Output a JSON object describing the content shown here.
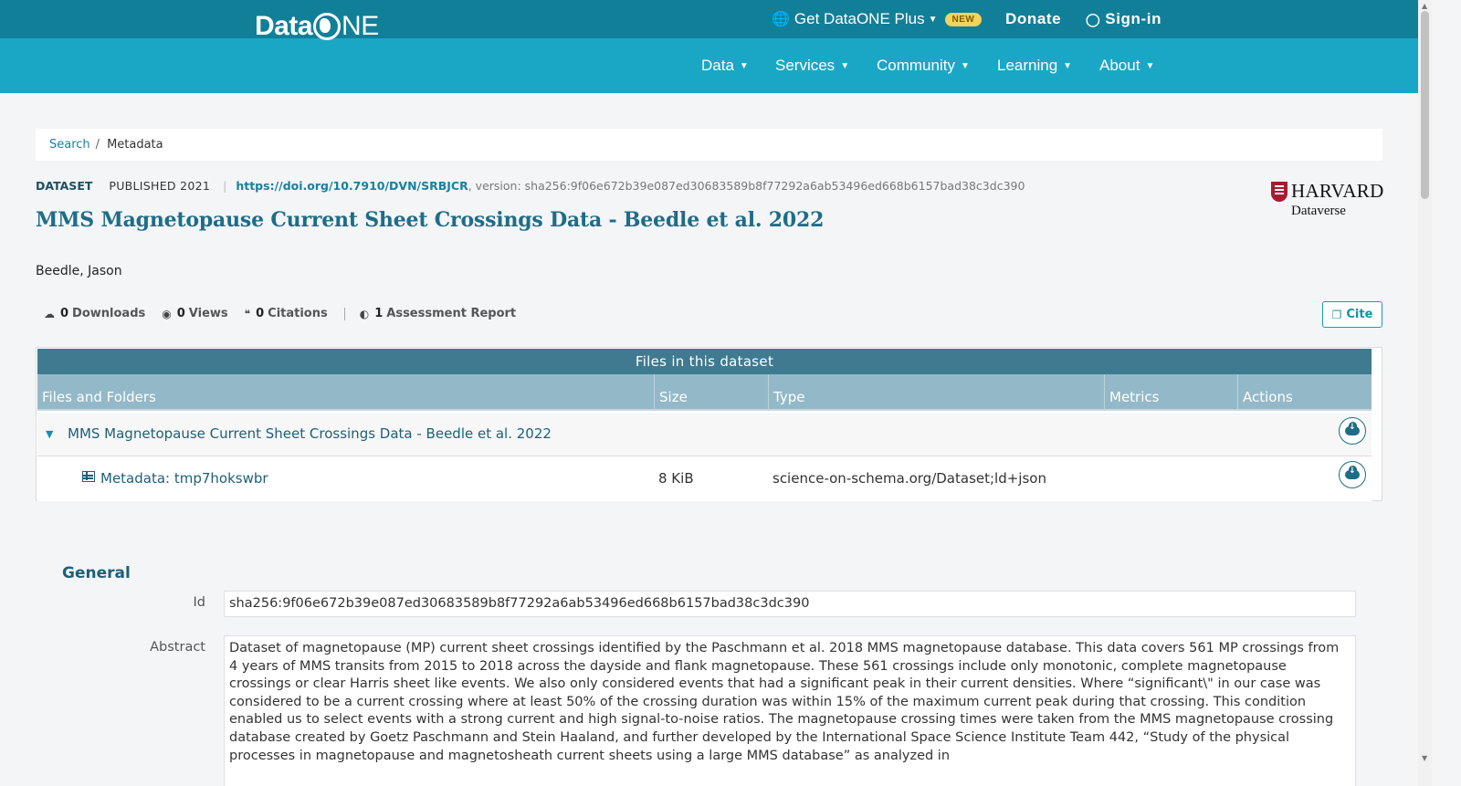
{
  "utility": {
    "plus_label": "Get DataONE Plus",
    "new_badge": "NEW",
    "donate": "Donate",
    "signin": "Sign-in"
  },
  "nav": {
    "logo_a": "Data",
    "logo_b": "NE",
    "items": [
      "Data",
      "Services",
      "Community",
      "Learning",
      "About"
    ]
  },
  "breadcrumb": {
    "search": "Search",
    "separator": "/",
    "current": "Metadata"
  },
  "dataset": {
    "type": "DATASET",
    "published": "PUBLISHED 2021",
    "doi": "https://doi.org/10.7910/DVN/SRBJCR",
    "version": ", version: sha256:9f06e672b39e087ed30683589b8f77292a6ab53496ed668b6157bad38c3dc390",
    "title": "MMS Magnetopause Current Sheet Crossings Data - Beedle et al. 2022",
    "author": "Beedle, Jason",
    "repository_name": "HARVARD",
    "repository_sub": "Dataverse"
  },
  "stats": {
    "downloads_num": "0",
    "downloads_lbl": "Downloads",
    "views_num": "0",
    "views_lbl": "Views",
    "citations_num": "0",
    "citations_lbl": "Citations",
    "assessment_num": "1",
    "assessment_lbl": "Assessment Report",
    "cite_label": "Cite"
  },
  "files": {
    "caption": "Files in this dataset",
    "columns": [
      "Files and Folders",
      "Size",
      "Type",
      "Metrics",
      "Actions"
    ],
    "folder_name": "MMS Magnetopause Current Sheet Crossings Data - Beedle et al. 2022",
    "file": {
      "name": "Metadata: tmp7hokswbr",
      "size": "8 KiB",
      "type": "science-on-schema.org/Dataset;ld+json"
    }
  },
  "general": {
    "heading": "General",
    "id_label": "Id",
    "id_value": "sha256:9f06e672b39e087ed30683589b8f77292a6ab53496ed668b6157bad38c3dc390",
    "abstract_label": "Abstract",
    "abstract_value": "Dataset of magnetopause (MP) current sheet crossings identified by the Paschmann et al. 2018 MMS magnetopause database. This data covers 561 MP crossings from 4 years of MMS transits from 2015 to 2018 across the dayside and flank magnetopause. These 561 crossings include only monotonic, complete magnetopause crossings or clear Harris sheet like events. We also only considered events that had a significant peak in their current densities. Where “significant\\\" in our case was considered to be a current crossing where at least 50% of the crossing duration was within 15% of the maximum current peak during that crossing. This condition enabled us to select events with a strong current and high signal-to-noise ratios. The magnetopause crossing times were taken from the MMS magnetopause crossing database created by Goetz Paschmann and Stein Haaland, and further developed by the International Space Science Institute Team 442, “Study of the physical processes in magnetopause and magnetosheath current sheets using a large MMS database” as analyzed in"
  },
  "colors": {
    "utility_bar": "#127f98",
    "nav_bar": "#1aa7c6",
    "title": "#1e6d87",
    "table_caption": "#3f7a90",
    "table_header": "#93b9c8",
    "badge": "#f3d35a"
  }
}
